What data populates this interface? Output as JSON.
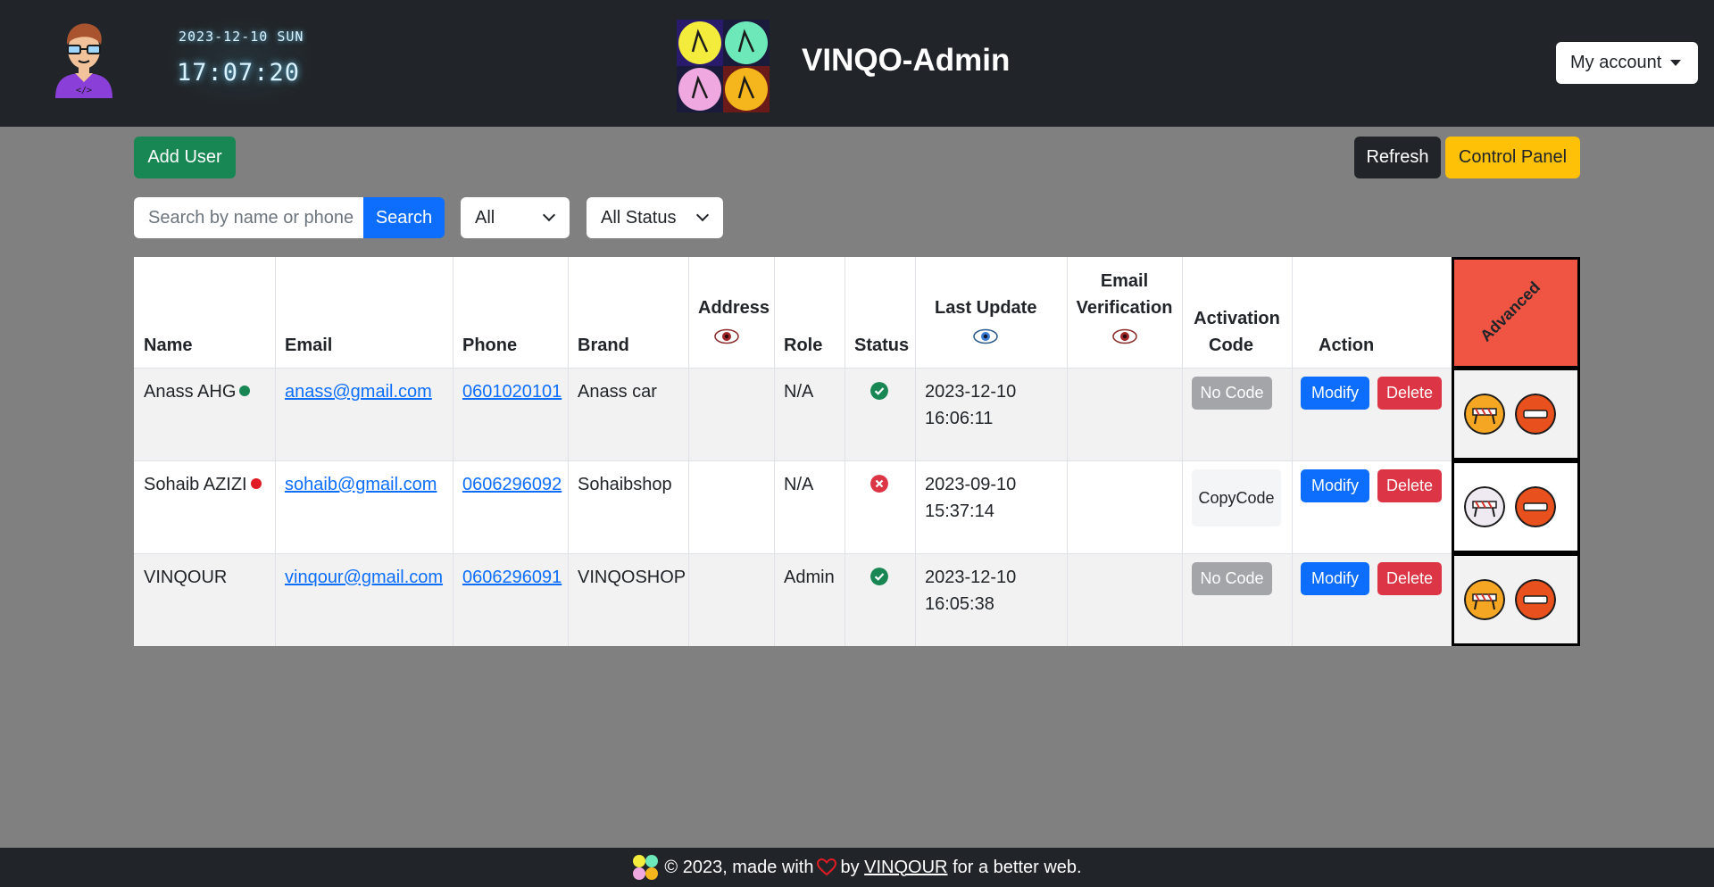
{
  "header": {
    "clock_date": "2023-12-10 SUN",
    "clock_time": "17:07:20",
    "title": "VINQO-Admin",
    "account_label": "My account"
  },
  "toolbar": {
    "add_user_label": "Add User",
    "refresh_label": "Refresh",
    "control_panel_label": "Control Panel",
    "search_placeholder": "Search by name or phone",
    "search_label": "Search",
    "role_filter_value": "All",
    "status_filter_value": "All Status"
  },
  "table": {
    "headers": {
      "name": "Name",
      "email": "Email",
      "phone": "Phone",
      "brand": "Brand",
      "address": "Address",
      "role": "Role",
      "status": "Status",
      "last_update": "Last Update",
      "email_verification_1": "Email",
      "email_verification_2": "Verification",
      "activation_1": "Activation",
      "activation_2": "Code",
      "action": "Action",
      "advanced": "Advanced"
    },
    "rows": [
      {
        "name": "Anass AHG",
        "online": true,
        "email": "anass@gmail.com",
        "phone": "0601020101",
        "brand": "Anass car",
        "address": "",
        "role": "N/A",
        "status": "active",
        "last_update_date": "2023-12-10",
        "last_update_time": "16:06:11",
        "email_verification": "",
        "activation_label": "No Code",
        "modify_label": "Modify",
        "delete_label": "Delete"
      },
      {
        "name": "Sohaib AZIZI",
        "online": false,
        "email": "sohaib@gmail.com",
        "phone": "0606296092",
        "brand": "Sohaibshop",
        "address": "",
        "role": "N/A",
        "status": "inactive",
        "last_update_date": "2023-09-10",
        "last_update_time": "15:37:14",
        "email_verification": "",
        "activation_label_1": "Copy",
        "activation_label_2": "Code",
        "modify_label": "Modify",
        "delete_label": "Delete"
      },
      {
        "name": "VINQOUR",
        "online": null,
        "email": "vinqour@gmail.com",
        "phone": "0606296091",
        "brand": "VINQOSHOP",
        "address": "",
        "role": "Admin",
        "status": "active",
        "last_update_date": "2023-12-10",
        "last_update_time": "16:05:38",
        "email_verification": "",
        "activation_label": "No Code",
        "modify_label": "Modify",
        "delete_label": "Delete"
      }
    ]
  },
  "footer": {
    "copyright": "© 2023, made with",
    "by": "by",
    "author": "VINQOUR",
    "tagline": "for a better web."
  },
  "colors": {
    "header_bg": "#212529",
    "page_bg": "#808080",
    "primary": "#0d6efd",
    "success": "#198754",
    "danger": "#dc3545",
    "warning": "#ffc107",
    "advanced_header": "#f05544",
    "online_dot": "#198754",
    "offline_dot": "#e01b24"
  },
  "icons": {
    "avatar": "developer-avatar-icon",
    "logo": "vinqo-logo-icon",
    "eye": "eye-icon",
    "status_active": "check-circle-icon",
    "status_inactive": "x-circle-icon",
    "barrier": "barrier-icon",
    "block": "no-entry-icon",
    "heart": "heart-icon"
  }
}
